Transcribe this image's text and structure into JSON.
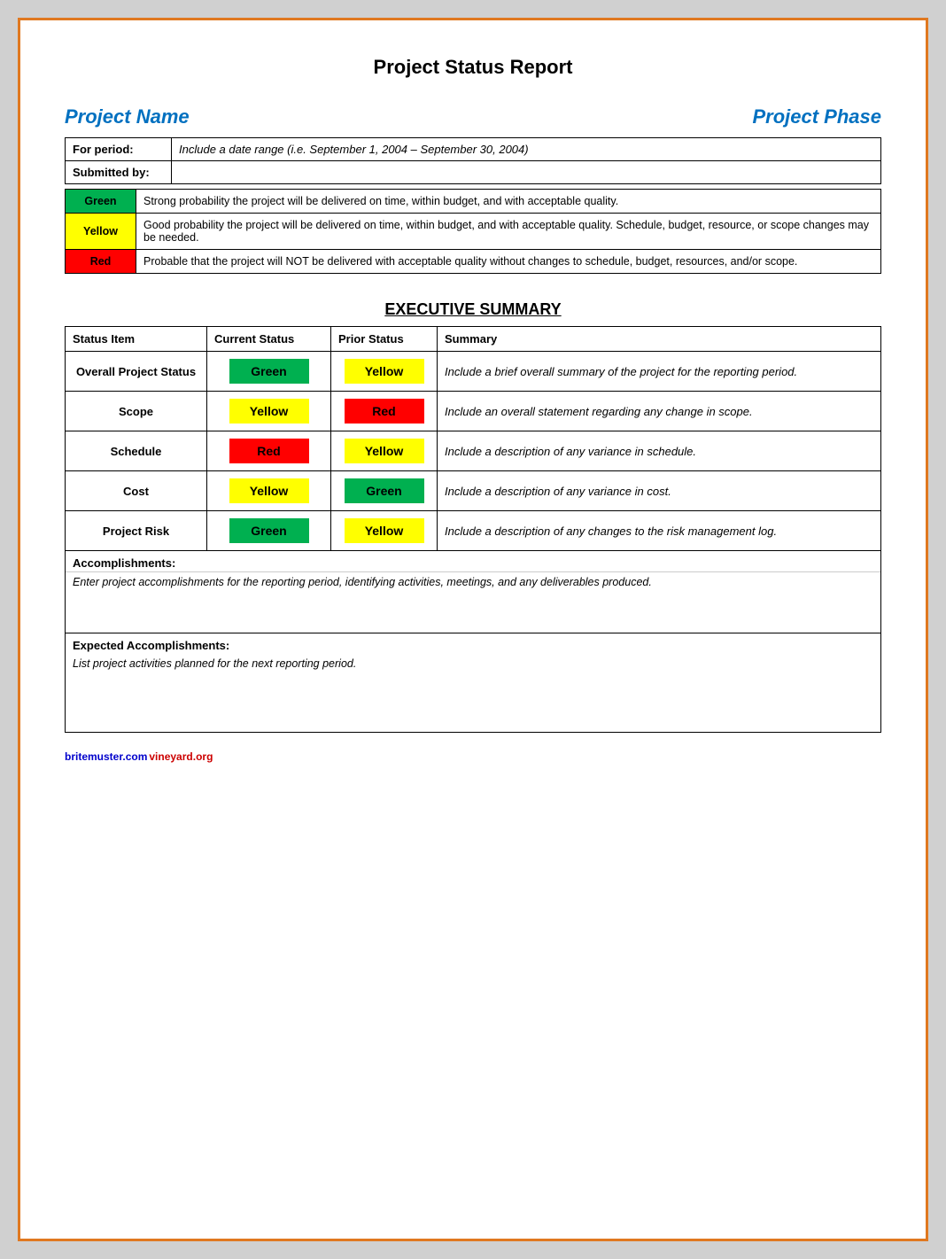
{
  "page": {
    "title": "Project Status Report",
    "projectNameLabel": "Project Name",
    "projectPhaseLabel": "Project Phase",
    "periodLabel": "For period:",
    "periodValue": "Include a date range (i.e. September 1, 2004 – September 30, 2004)",
    "submittedByLabel": "Submitted by:",
    "submittedByValue": "",
    "legendRows": [
      {
        "color": "Green",
        "colorClass": "color-green",
        "description": "Strong probability the project will be delivered on time, within budget, and with acceptable quality."
      },
      {
        "color": "Yellow",
        "colorClass": "color-yellow",
        "description": "Good probability the project will be delivered on time, within budget, and with acceptable quality. Schedule, budget, resource, or scope changes may be needed."
      },
      {
        "color": "Red",
        "colorClass": "color-red",
        "description": "Probable that the project will NOT be delivered with acceptable quality without changes to schedule, budget, resources, and/or scope."
      }
    ],
    "execSummaryTitle": "EXECUTIVE SUMMARY",
    "tableHeaders": {
      "statusItem": "Status Item",
      "currentStatus": "Current Status",
      "priorStatus": "Prior Status",
      "summary": "Summary"
    },
    "tableRows": [
      {
        "statusItem": "Overall Project Status",
        "currentStatus": "Green",
        "currentClass": "color-green",
        "priorStatus": "Yellow",
        "priorClass": "color-yellow",
        "summary": "Include a brief overall summary of the project for the reporting period."
      },
      {
        "statusItem": "Scope",
        "currentStatus": "Yellow",
        "currentClass": "color-yellow",
        "priorStatus": "Red",
        "priorClass": "color-red",
        "summary": "Include an overall statement regarding any change in scope."
      },
      {
        "statusItem": "Schedule",
        "currentStatus": "Red",
        "currentClass": "color-red",
        "priorStatus": "Yellow",
        "priorClass": "color-yellow",
        "summary": "Include a description of any variance in schedule."
      },
      {
        "statusItem": "Cost",
        "currentStatus": "Yellow",
        "currentClass": "color-yellow",
        "priorStatus": "Green",
        "priorClass": "color-green",
        "summary": "Include a description of any variance in cost."
      },
      {
        "statusItem": "Project Risk",
        "currentStatus": "Green",
        "currentClass": "color-green",
        "priorStatus": "Yellow",
        "priorClass": "color-yellow",
        "summary": "Include a description of any changes to the risk management log."
      }
    ],
    "accomplishmentsLabel": "Accomplishments:",
    "accomplishmentsBody": "Enter project accomplishments for the reporting period, identifying activities, meetings, and any deliverables produced.",
    "expectedLabel": "Expected Accomplishments:",
    "expectedBody": "List project activities planned for the next reporting period.",
    "footerBlue": "britemuster.com",
    "footerRed": "vineyard.org"
  }
}
